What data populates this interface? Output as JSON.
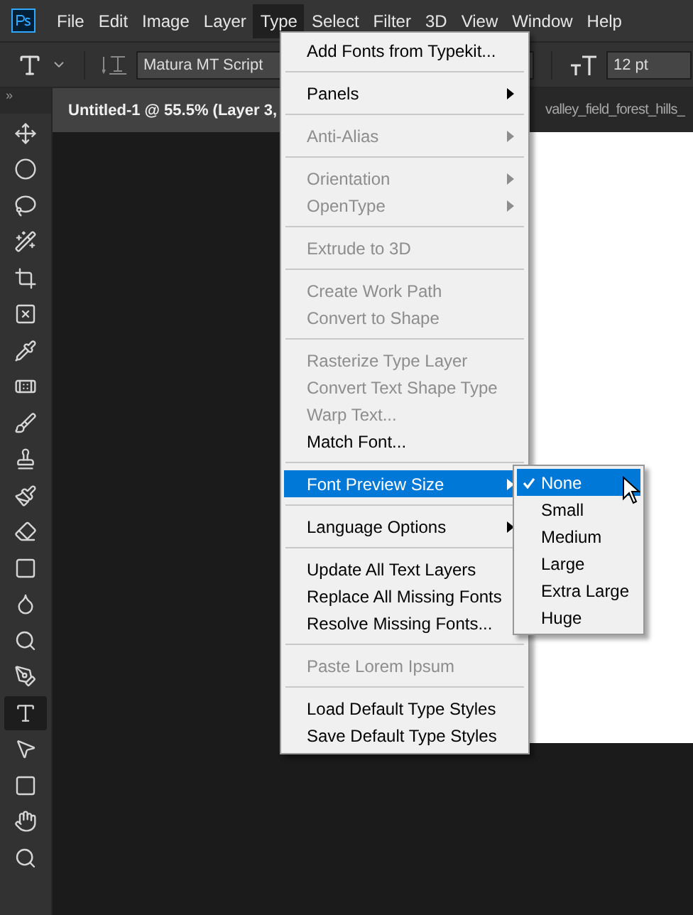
{
  "menubar": {
    "items": [
      {
        "label": "File",
        "selected": false
      },
      {
        "label": "Edit",
        "selected": false
      },
      {
        "label": "Image",
        "selected": false
      },
      {
        "label": "Layer",
        "selected": false
      },
      {
        "label": "Type",
        "selected": true
      },
      {
        "label": "Select",
        "selected": false
      },
      {
        "label": "Filter",
        "selected": false
      },
      {
        "label": "3D",
        "selected": false
      },
      {
        "label": "View",
        "selected": false
      },
      {
        "label": "Window",
        "selected": false
      },
      {
        "label": "Help",
        "selected": false
      }
    ]
  },
  "options_bar": {
    "font_family": "Matura MT Script",
    "font_size": "12 pt"
  },
  "document_tabs": [
    {
      "label": "Untitled-1 @ 55.5% (Layer 3,",
      "selected": true
    },
    {
      "label": "valley_field_forest_hills_",
      "selected": false
    }
  ],
  "toolbar_collapse": "»",
  "tools": [
    {
      "selected": false
    },
    {
      "selected": false
    },
    {
      "selected": false
    },
    {
      "selected": false
    },
    {
      "selected": false
    },
    {
      "selected": false
    },
    {
      "selected": false
    },
    {
      "selected": false
    },
    {
      "selected": false
    },
    {
      "selected": false
    },
    {
      "selected": false
    },
    {
      "selected": false
    },
    {
      "selected": false
    },
    {
      "selected": false
    },
    {
      "selected": false
    },
    {
      "selected": false
    },
    {
      "selected": true
    },
    {
      "selected": false
    },
    {
      "selected": false
    },
    {
      "selected": false
    },
    {
      "selected": false
    }
  ],
  "type_menu": [
    {
      "kind": "item",
      "label": "Add Fonts from Typekit...",
      "disabled": false,
      "submenu": false,
      "selected": false
    },
    {
      "kind": "separator"
    },
    {
      "kind": "item",
      "label": "Panels",
      "disabled": false,
      "submenu": true,
      "selected": false
    },
    {
      "kind": "separator"
    },
    {
      "kind": "item",
      "label": "Anti-Alias",
      "disabled": true,
      "submenu": true,
      "selected": false
    },
    {
      "kind": "separator"
    },
    {
      "kind": "item",
      "label": "Orientation",
      "disabled": true,
      "submenu": true,
      "selected": false
    },
    {
      "kind": "item",
      "label": "OpenType",
      "disabled": true,
      "submenu": true,
      "selected": false
    },
    {
      "kind": "separator"
    },
    {
      "kind": "item",
      "label": "Extrude to 3D",
      "disabled": true,
      "submenu": false,
      "selected": false
    },
    {
      "kind": "separator"
    },
    {
      "kind": "item",
      "label": "Create Work Path",
      "disabled": true,
      "submenu": false,
      "selected": false
    },
    {
      "kind": "item",
      "label": "Convert to Shape",
      "disabled": true,
      "submenu": false,
      "selected": false
    },
    {
      "kind": "separator"
    },
    {
      "kind": "item",
      "label": "Rasterize Type Layer",
      "disabled": true,
      "submenu": false,
      "selected": false
    },
    {
      "kind": "item",
      "label": "Convert Text Shape Type",
      "disabled": true,
      "submenu": false,
      "selected": false
    },
    {
      "kind": "item",
      "label": "Warp Text...",
      "disabled": true,
      "submenu": false,
      "selected": false
    },
    {
      "kind": "item",
      "label": "Match Font...",
      "disabled": false,
      "submenu": false,
      "selected": false
    },
    {
      "kind": "separator"
    },
    {
      "kind": "item",
      "label": "Font Preview Size",
      "disabled": false,
      "submenu": true,
      "selected": true
    },
    {
      "kind": "separator"
    },
    {
      "kind": "item",
      "label": "Language Options",
      "disabled": false,
      "submenu": true,
      "selected": false
    },
    {
      "kind": "separator"
    },
    {
      "kind": "item",
      "label": "Update All Text Layers",
      "disabled": false,
      "submenu": false,
      "selected": false
    },
    {
      "kind": "item",
      "label": "Replace All Missing Fonts",
      "disabled": false,
      "submenu": false,
      "selected": false
    },
    {
      "kind": "item",
      "label": "Resolve Missing Fonts...",
      "disabled": false,
      "submenu": false,
      "selected": false
    },
    {
      "kind": "separator"
    },
    {
      "kind": "item",
      "label": "Paste Lorem Ipsum",
      "disabled": true,
      "submenu": false,
      "selected": false
    },
    {
      "kind": "separator"
    },
    {
      "kind": "item",
      "label": "Load Default Type Styles",
      "disabled": false,
      "submenu": false,
      "selected": false
    },
    {
      "kind": "item",
      "label": "Save Default Type Styles",
      "disabled": false,
      "submenu": false,
      "selected": false
    }
  ],
  "font_preview_submenu": [
    {
      "label": "None",
      "checked": true,
      "selected": true
    },
    {
      "label": "Small",
      "checked": false,
      "selected": false
    },
    {
      "label": "Medium",
      "checked": false,
      "selected": false
    },
    {
      "label": "Large",
      "checked": false,
      "selected": false
    },
    {
      "label": "Extra Large",
      "checked": false,
      "selected": false
    },
    {
      "label": "Huge",
      "checked": false,
      "selected": false
    }
  ]
}
